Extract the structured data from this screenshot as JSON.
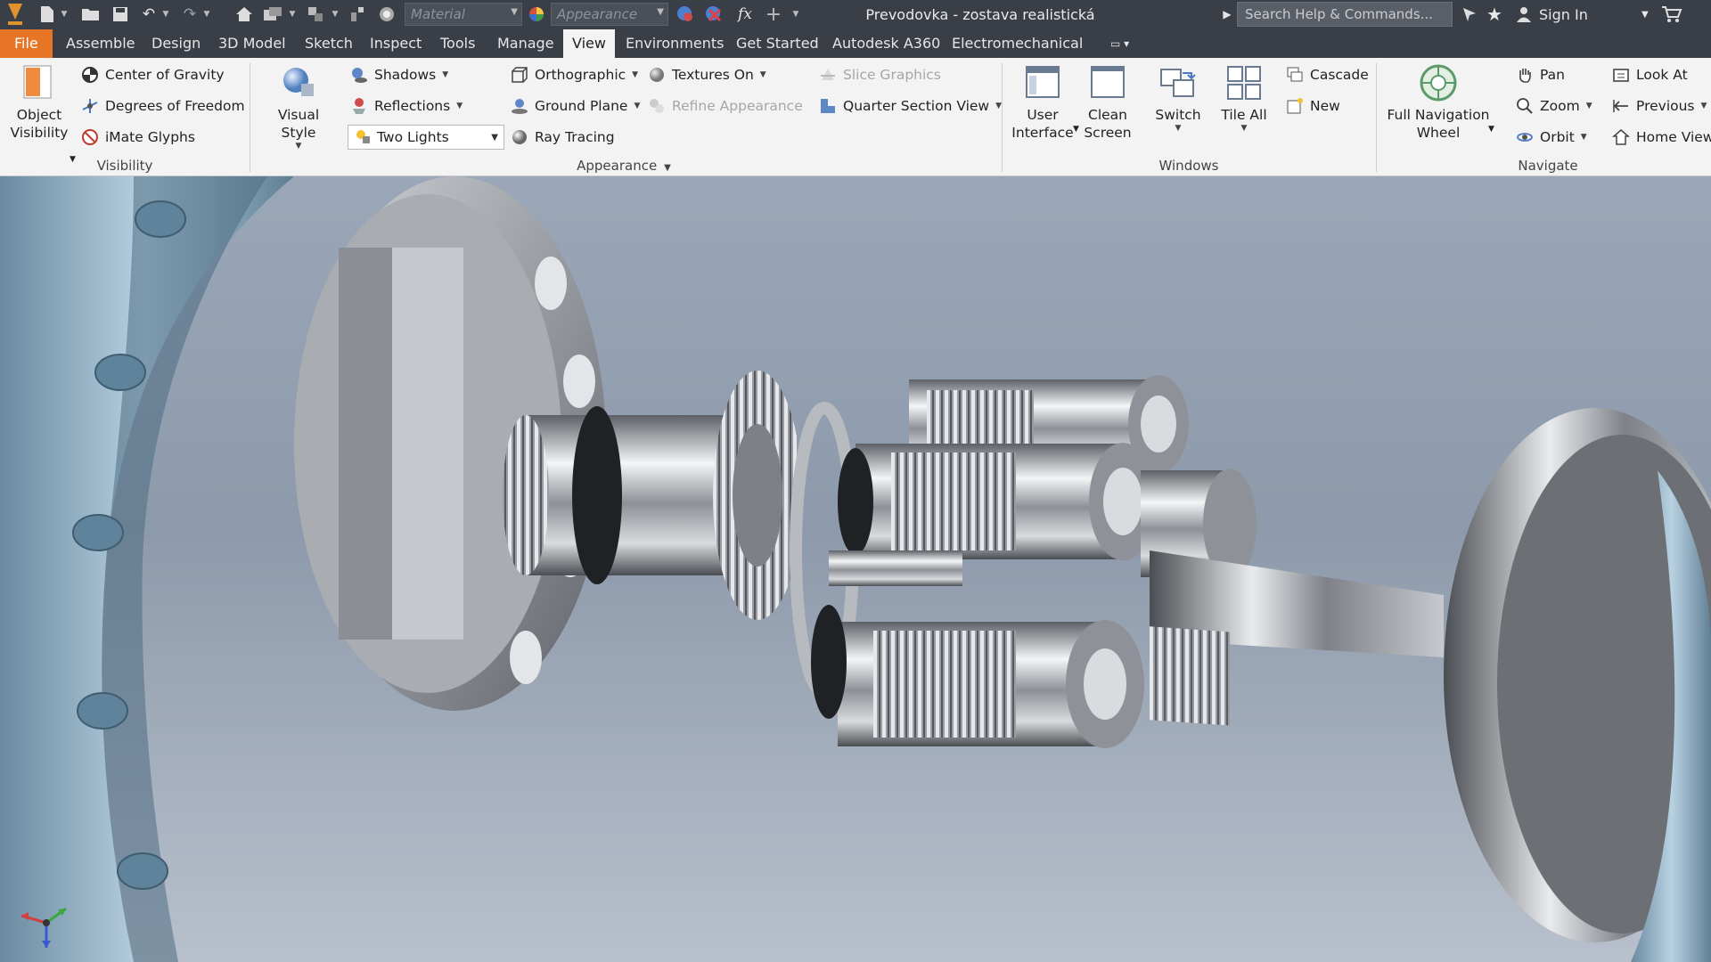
{
  "titlebar": {
    "window_title": "Prevodovka - zostava realistická",
    "material_placeholder": "Material",
    "appearance_placeholder": "Appearance",
    "search_placeholder": "Search Help & Commands...",
    "sign_in": "Sign In",
    "fx": "fx"
  },
  "tabs": [
    "File",
    "Assemble",
    "Design",
    "3D Model",
    "Sketch",
    "Inspect",
    "Tools",
    "Manage",
    "View",
    "Environments",
    "Get Started",
    "Autodesk A360",
    "Electromechanical"
  ],
  "active_tab": "View",
  "ribbon": {
    "visibility": {
      "label": "Visibility",
      "object_visibility_1": "Object",
      "object_visibility_2": "Visibility",
      "center_of_gravity": "Center of Gravity",
      "degrees_of_freedom": "Degrees of Freedom",
      "imate_glyphs": "iMate Glyphs"
    },
    "appearance": {
      "label": "Appearance",
      "visual_style": "Visual Style",
      "shadows": "Shadows",
      "reflections": "Reflections",
      "lighting": "Two Lights",
      "orthographic": "Orthographic",
      "ground_plane": "Ground Plane",
      "ray_tracing": "Ray Tracing",
      "textures_on": "Textures On",
      "refine_appearance": "Refine Appearance",
      "slice_graphics": "Slice Graphics",
      "quarter_section_view": "Quarter Section View"
    },
    "windows": {
      "label": "Windows",
      "user_interface_1": "User",
      "user_interface_2": "Interface",
      "clean_screen_1": "Clean",
      "clean_screen_2": "Screen",
      "switch": "Switch",
      "tile_all": "Tile All",
      "cascade": "Cascade",
      "new": "New"
    },
    "navigate": {
      "label": "Navigate",
      "full_nav_1": "Full Navigation",
      "full_nav_2": "Wheel",
      "pan": "Pan",
      "zoom": "Zoom",
      "orbit": "Orbit",
      "look_at": "Look At",
      "previous": "Previous",
      "home_view": "Home View"
    }
  },
  "colors": {
    "file_tab": "#e67525",
    "title_bar": "#3a3f47",
    "ribbon": "#f3f3f3"
  }
}
